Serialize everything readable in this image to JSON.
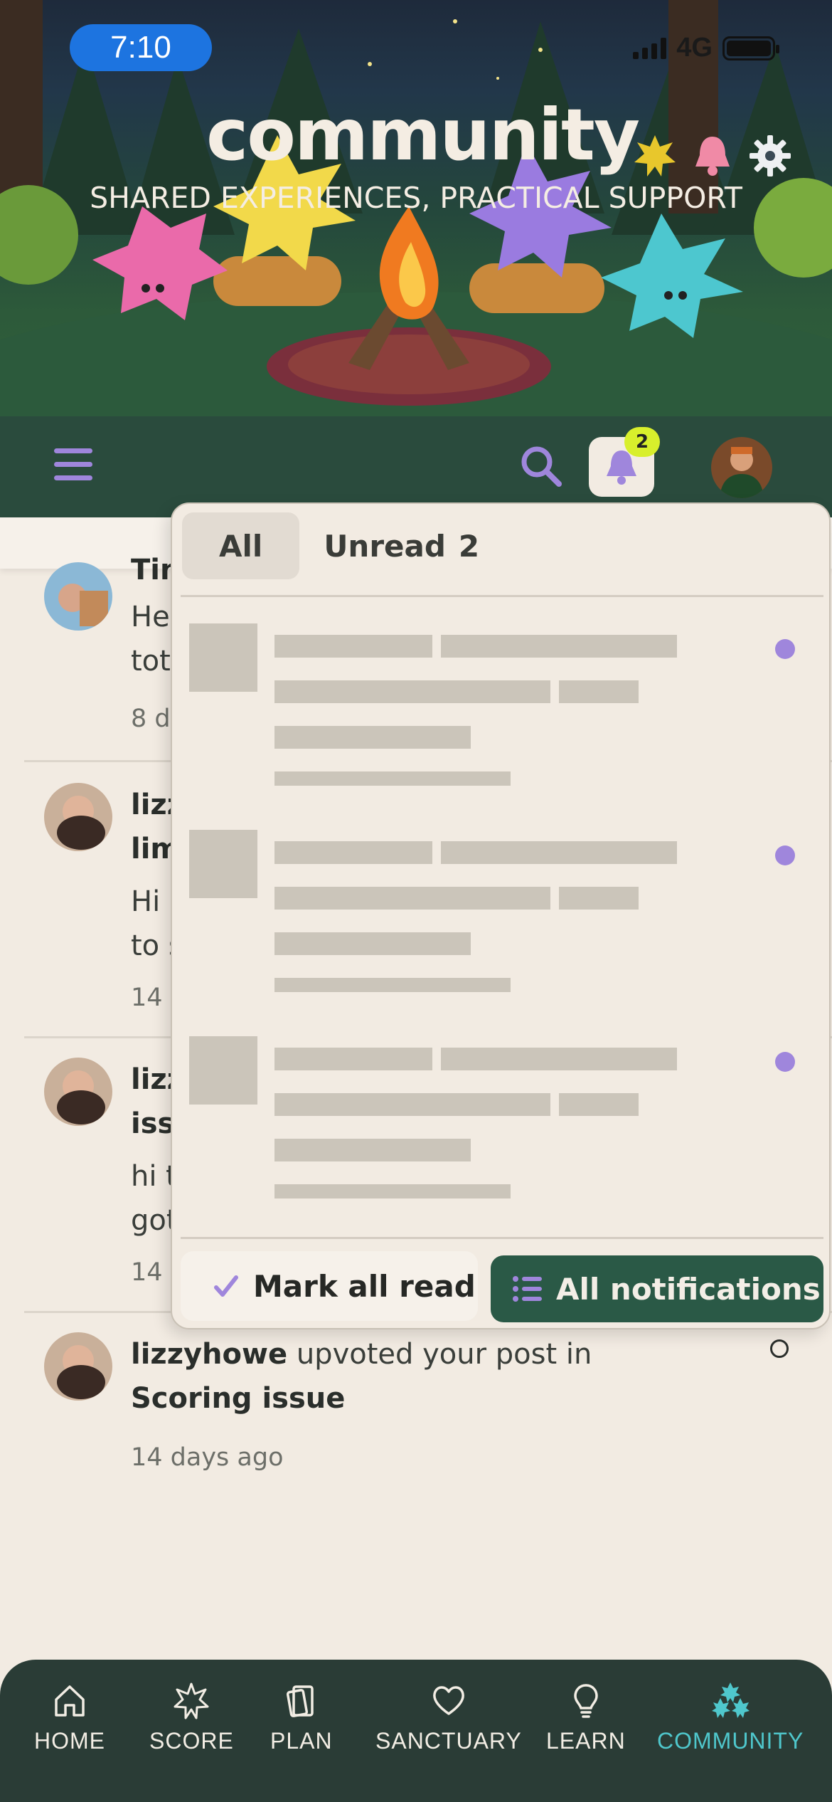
{
  "status_bar": {
    "time": "7:10",
    "network": "4G"
  },
  "hero": {
    "title": "community",
    "subtitle": "SHARED EXPERIENCES, PRACTICAL SUPPORT"
  },
  "topbar": {
    "notification_count": "2"
  },
  "panel": {
    "tabs": [
      {
        "label": "All"
      },
      {
        "label": "Unread",
        "count": "2"
      }
    ],
    "mark_all_read": "Mark all read",
    "all_notifications": "All notifications"
  },
  "notifications": [
    {
      "user": "Tin",
      "text": "He",
      "text2": "tot",
      "time": "8 d"
    },
    {
      "user": "lizz",
      "user2": "lim",
      "text": "Hi",
      "text2": "to s",
      "time": "14 d"
    },
    {
      "user": "lizz",
      "user2": "iss",
      "text": "hi t",
      "text2": "got",
      "time": "14 d"
    },
    {
      "user": "lizzyhowe",
      "action": " upvoted your post in ",
      "target": "Scoring issue",
      "time": "14 days ago"
    }
  ],
  "bottom_nav": [
    {
      "label": "HOME",
      "icon": "home-icon"
    },
    {
      "label": "SCORE",
      "icon": "score-icon"
    },
    {
      "label": "PLAN",
      "icon": "plan-icon"
    },
    {
      "label": "SANCTUARY",
      "icon": "heart-icon"
    },
    {
      "label": "LEARN",
      "icon": "lightbulb-icon"
    },
    {
      "label": "COMMUNITY",
      "icon": "community-icon",
      "active": true
    }
  ],
  "colors": {
    "accent_green": "#2a5946",
    "topbar": "#2a4b3d",
    "unread_dot": "#9f86dc",
    "active_nav": "#4fc7cc",
    "badge": "#d8ef2c"
  }
}
